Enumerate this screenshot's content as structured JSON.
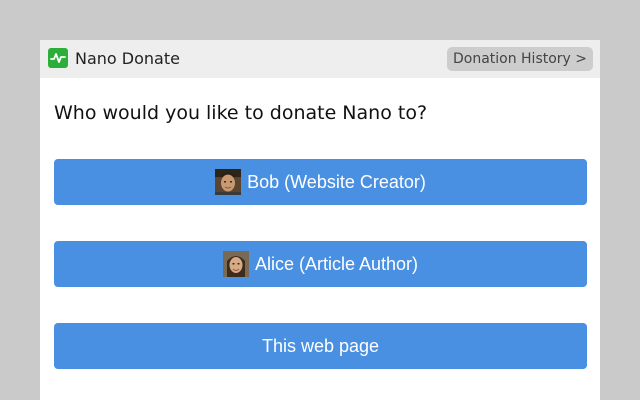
{
  "header": {
    "app_title": "Nano Donate",
    "history_label": "Donation History >",
    "logo_icon": "nano-pulse-icon",
    "logo_color": "#2cae3a"
  },
  "main": {
    "question": "Who would you like to donate Nano to?",
    "options": [
      {
        "label": "Bob (Website Creator)",
        "avatar": "bob-avatar"
      },
      {
        "label": "Alice (Article Author)",
        "avatar": "alice-avatar"
      },
      {
        "label": "This web page"
      }
    ]
  },
  "colors": {
    "button_blue": "#4a90e2",
    "header_bg": "#eeeeee",
    "history_bg": "#cdcdcd"
  }
}
